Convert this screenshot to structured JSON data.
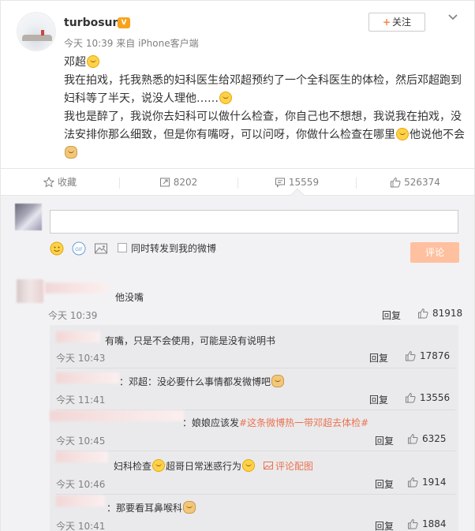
{
  "post": {
    "username": "turbosun",
    "vip_badge": "V",
    "time": "今天 10:39",
    "source_prefix": "来自",
    "source": "iPhone客户端",
    "follow_label": "关注",
    "line1": "邓超",
    "line2": "我在拍戏，托我熟悉的妇科医生给邓超预约了一个全科医生的体检，然后邓超跑到妇科等了半天，说没人理他……",
    "line3a": "我也是醉了，我说你去妇科可以做什么检查，你自己也不想想，我说我在拍戏，没法安排你那么细致，但是你有嘴呀，可以问呀，你做什么检查在哪里",
    "line3b": "他说他不会"
  },
  "actions": {
    "favorite": "收藏",
    "repost_count": "8202",
    "comment_count": "15559",
    "like_count": "526374"
  },
  "composer": {
    "repost_label": "同时转发到我的微博",
    "submit_label": "评论"
  },
  "comments": [
    {
      "text": "他没嘴",
      "time": "今天 10:39",
      "reply": "回复",
      "likes": "81918"
    }
  ],
  "sub_comments": [
    {
      "text": "有嘴，只是不会使用，可能是没有说明书",
      "time": "今天 10:43",
      "reply": "回复",
      "likes": "17876"
    },
    {
      "text": "：邓超：没必要什么事情都发微博吧",
      "time": "今天 11:41",
      "reply": "回复",
      "likes": "13556"
    },
    {
      "text_pre": "：娘娘应该发",
      "hashtag": "#这条微博热一带邓超去体检#",
      "time": "今天 10:45",
      "reply": "回复",
      "likes": "6325"
    },
    {
      "text_a": "妇科检查",
      "text_b": "超哥日常迷惑行为",
      "pic_link": "评论配图",
      "time": "今天 10:46",
      "reply": "回复",
      "likes": "1914"
    },
    {
      "text": "：那要看耳鼻喉科",
      "time": "今天 10:41",
      "reply": "回复",
      "likes": "1884"
    }
  ]
}
